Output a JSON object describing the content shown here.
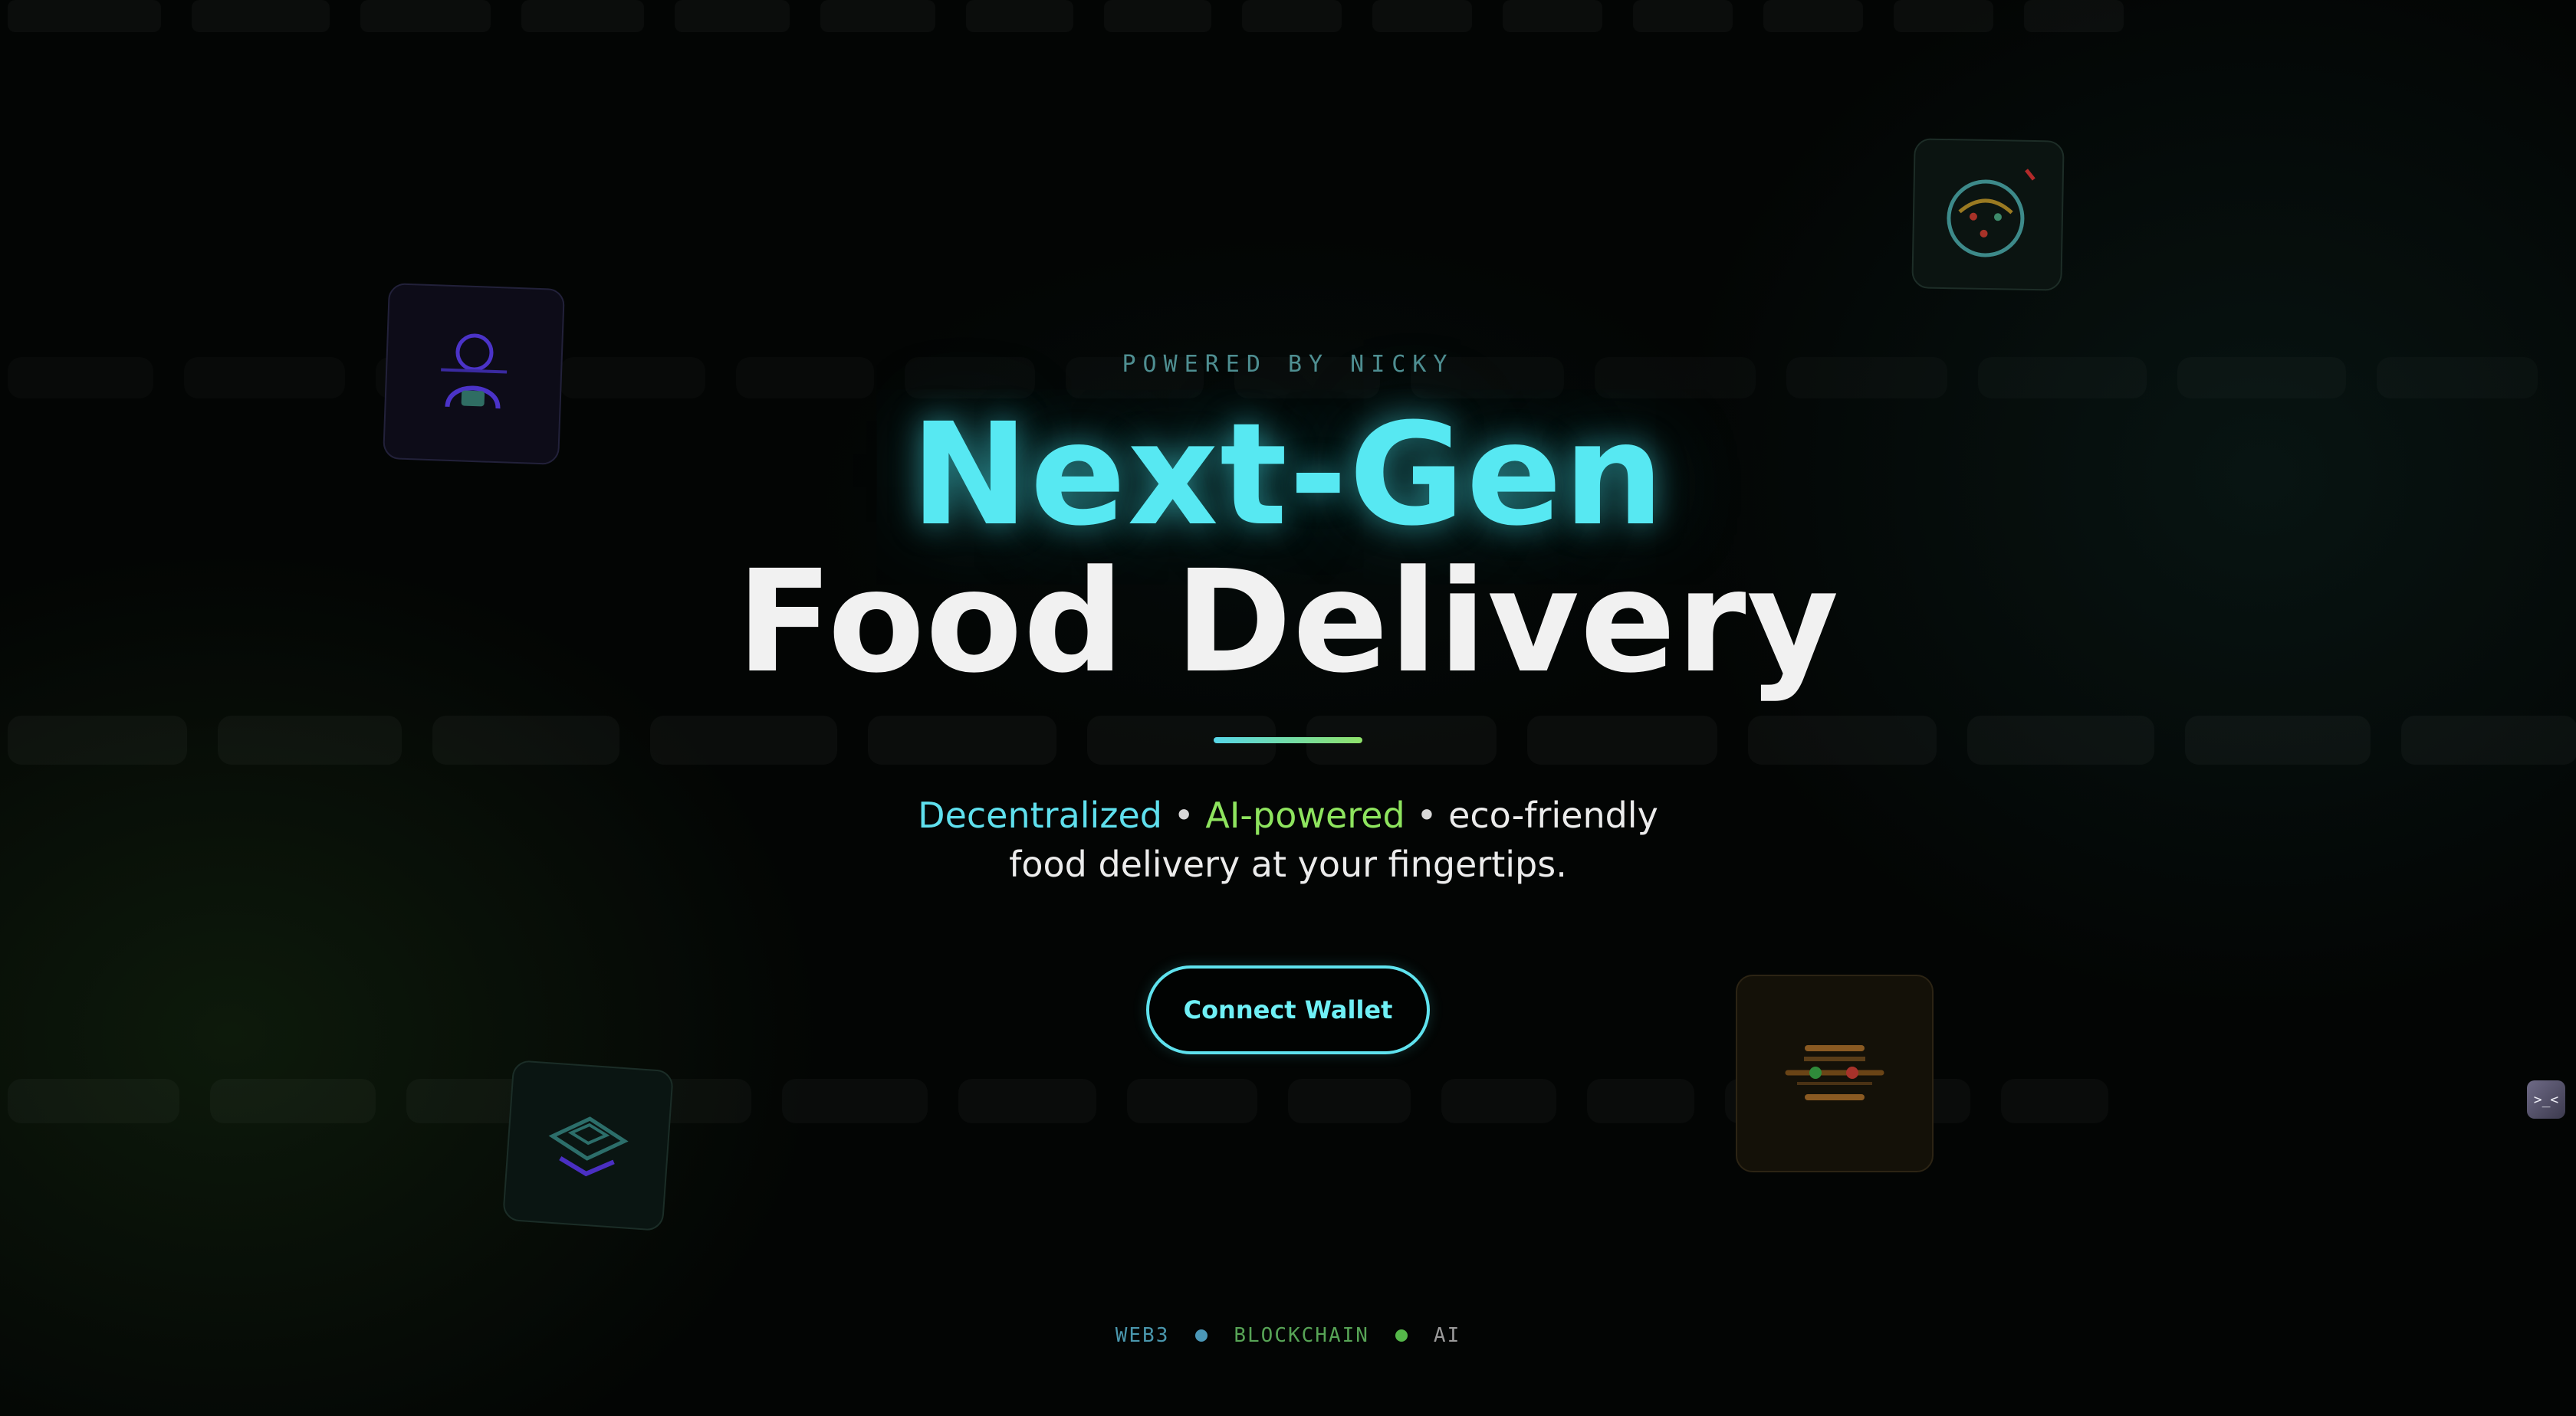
{
  "hero": {
    "eyebrow": "POWERED BY NICKY",
    "title_line1": "Next-Gen",
    "title_line2": "Food Delivery",
    "subtitle": {
      "highlight_cyan": "Decentralized",
      "separator": "•",
      "highlight_green": "AI-powered",
      "plain_after": "eco-friendly",
      "line2": "food delivery at your fingertips."
    },
    "cta_label": "Connect Wallet"
  },
  "tags": {
    "items": [
      "WEB3",
      "BLOCKCHAIN",
      "AI"
    ]
  },
  "corner_widget": {
    "glyph": ">_<"
  },
  "icons": {
    "card_1": "user-icon",
    "card_2": "scale-gauge-icon",
    "card_3": "cube-icon",
    "card_4": "burger-icon"
  },
  "colors": {
    "accent_cyan": "#57e8f2",
    "accent_green": "#8ee45e",
    "background": "#030504"
  }
}
